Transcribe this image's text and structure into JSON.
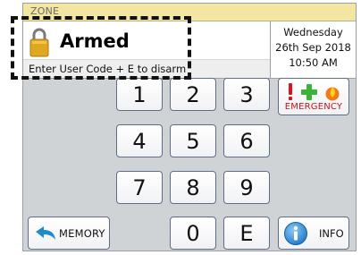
{
  "zone": {
    "label": "ZONE"
  },
  "status": {
    "text": "Armed",
    "hint": "Enter User Code + E to disarm",
    "icon": "padlock-icon"
  },
  "datetime": {
    "day": "Wednesday",
    "date": "26th Sep 2018",
    "time": "10:50 AM"
  },
  "keypad": {
    "keys": [
      "1",
      "2",
      "3",
      "4",
      "5",
      "6",
      "7",
      "8",
      "9",
      "0",
      "E"
    ]
  },
  "buttons": {
    "memory": "MEMORY",
    "info": "INFO",
    "emergency": "EMERGENCY"
  },
  "colors": {
    "panel_bg": "#cfd3d6",
    "zone_bar": "#f3e6a2",
    "key_border": "#5f6e86",
    "emergency_red": "#c4121a",
    "medical_green": "#3bb33b",
    "fire_orange": "#f07a1a",
    "info_blue": "#2d8fd8"
  }
}
